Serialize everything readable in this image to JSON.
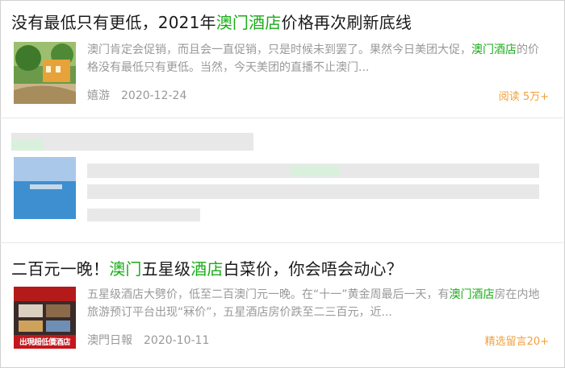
{
  "results": [
    {
      "title_parts": [
        {
          "text": "没有最低只有更低，2021年",
          "hl": false
        },
        {
          "text": "澳门酒店",
          "hl": true
        },
        {
          "text": "价格再次刷新底线",
          "hl": false
        }
      ],
      "snippet_parts": [
        {
          "text": "澳门肯定会促销，而且会一直促销，只是时候未到罢了。果然今日美团大促，",
          "hl": false
        },
        {
          "text": "澳门酒店",
          "hl": true
        },
        {
          "text": "的价格没有最低只有更低。当然，今天美团的直播不止澳门...",
          "hl": false
        }
      ],
      "source": "嬉游",
      "date": "2020-12-24",
      "stat": "阅读 5万+",
      "thumbnail_icon": "resort-photo-icon"
    },
    {
      "blurred": true,
      "thumbnail_icon": "pool-photo-icon"
    },
    {
      "title_parts": [
        {
          "text": "二百元一晚！",
          "hl": false
        },
        {
          "text": "澳门",
          "hl": true
        },
        {
          "text": "五星级",
          "hl": false
        },
        {
          "text": "酒店",
          "hl": true
        },
        {
          "text": "白菜价，你会唔会动心？",
          "hl": false
        }
      ],
      "snippet_parts": [
        {
          "text": "五星级酒店大劈价，低至二百澳门元一晚。在“十一”黄金周最后一天，有",
          "hl": false
        },
        {
          "text": "澳门酒店",
          "hl": true
        },
        {
          "text": "房在内地旅游预订平台出现“冧价”，五星酒店房价跌至二三百元，近...",
          "hl": false
        }
      ],
      "source": "澳門日報",
      "date": "2020-10-11",
      "stat": "精选留言20+",
      "thumbnail_icon": "hotel-ad-icon",
      "thumbnail_text": "出現超低價酒店"
    }
  ],
  "colors": {
    "highlight": "#1aad19",
    "stat": "#f0a13b",
    "meta": "#999999",
    "title": "#1a1a1a"
  }
}
